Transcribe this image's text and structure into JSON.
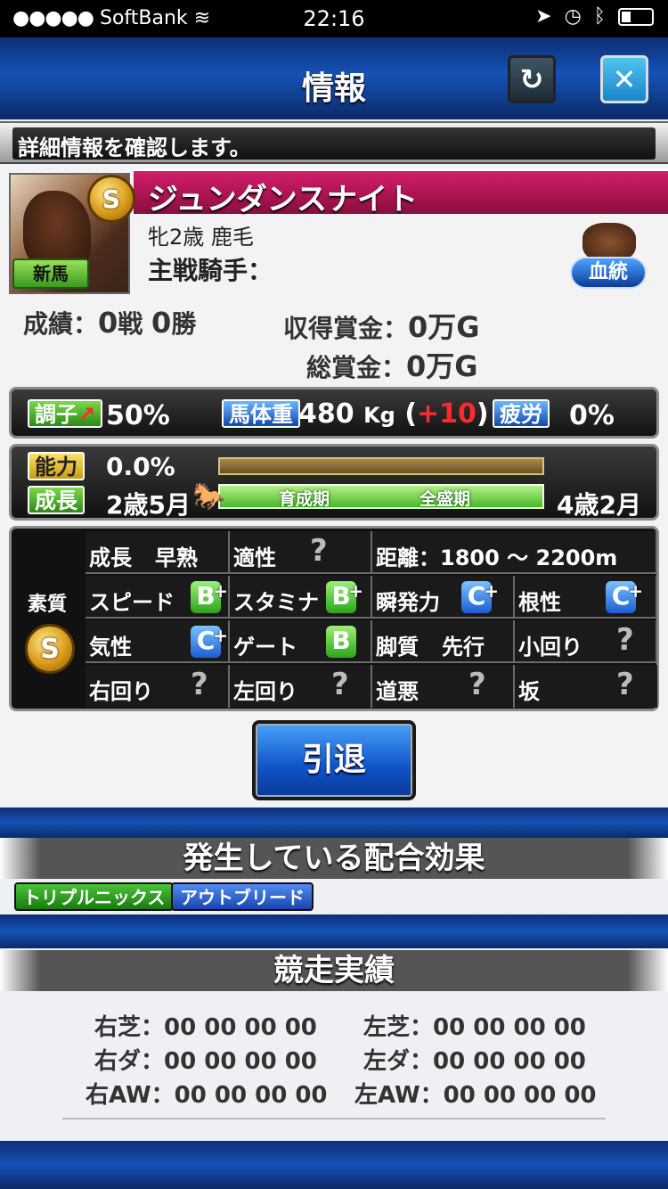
{
  "status": {
    "dots": "●●●●●",
    "carrier": "SoftBank",
    "wifi": "wifi-icon",
    "time": "22:16"
  },
  "header": {
    "title": "情報",
    "refresh_icon": "↻",
    "close_icon": "✕"
  },
  "info_message": "詳細情報を確認します。",
  "horse": {
    "name": "ジュンダンスナイト",
    "rank": "S",
    "badge": "新馬",
    "sub": "牝2歳 鹿毛",
    "jockey": "主戦騎手：",
    "pedigree_label": "血統"
  },
  "record": {
    "seiseki": "成績：",
    "sen_val": "0",
    "sen_unit": "戦",
    "win_val": "0",
    "win_unit": "勝",
    "shutoku_label": "収得賞金：",
    "shutoku_val": "0万G",
    "sou_label": "総賞金：",
    "sou_val": "0万G"
  },
  "condition": {
    "label": "調子",
    "arrow": "↗",
    "value": "50%",
    "weight_label": "馬体重",
    "weight": "480",
    "weight_unit": "Kg",
    "paren_l": "(",
    "weight_diff": "+10",
    "paren_r": ")",
    "fatigue_label": "疲労",
    "fatigue": "0%"
  },
  "ability": {
    "label": "能力",
    "value": "0.0%",
    "growth_label": "成長",
    "growth_start": "2歳5月",
    "bar_a": "育成期",
    "bar_b": "全盛期",
    "growth_end": "4歳2月",
    "ability_fraction": 0.0,
    "growth_fraction": 1.0
  },
  "aptitude": {
    "side_label": "素質",
    "side_rank": "S",
    "seicho_label": "成長",
    "seicho_val": "早熟",
    "tekisei": "適性",
    "q": "?",
    "kyori_label": "距離：",
    "kyori_val": "1800 〜 2200m",
    "speed": "スピード",
    "speed_g": "B",
    "stamina": "スタミナ",
    "stamina_g": "B",
    "shunpatsu": "瞬発力",
    "shunpatsu_g": "C",
    "konjo": "根性",
    "konjo_g": "C",
    "kisho": "気性",
    "kisho_g": "C",
    "gate": "ゲート",
    "gate_g": "B",
    "kyakushitsu": "脚質",
    "kyakushitsu_val": "先行",
    "kokaiori": "小回り",
    "migi": "右回り",
    "hidari": "左回り",
    "dowaru": "道悪",
    "saka": "坂",
    "plus": "+"
  },
  "retire_label": "引退",
  "effects": {
    "title": "発生している配合効果",
    "items": [
      "トリプルニックス",
      "アウトブリード"
    ]
  },
  "results": {
    "title": "競走実績",
    "rows": [
      {
        "l_label": "右芝：",
        "l_val": "00 00 00 00",
        "r_label": "左芝：",
        "r_val": "00 00 00 00"
      },
      {
        "l_label": "右ダ：",
        "l_val": "00 00 00 00",
        "r_label": "左ダ：",
        "r_val": "00 00 00 00"
      },
      {
        "l_label": "右AW：",
        "l_val": "00 00 00 00",
        "r_label": "左AW：",
        "r_val": "00 00 00 00"
      }
    ]
  }
}
